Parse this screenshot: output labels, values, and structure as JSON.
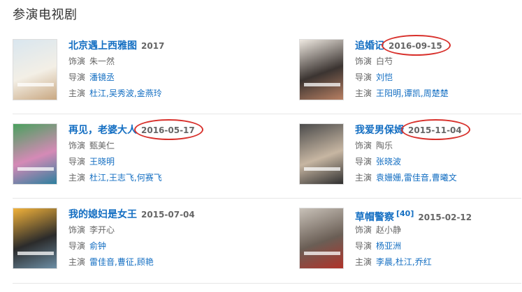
{
  "section": {
    "title": "参演电视剧"
  },
  "labels": {
    "role": "饰演",
    "director": "导演",
    "cast": "主演"
  },
  "dramas": [
    {
      "title": "北京遇上西雅图",
      "sup": "",
      "date": "2017",
      "role": "朱一然",
      "director": "潘镜丞",
      "cast": [
        "杜江",
        "吴秀波",
        "金燕玲"
      ],
      "poster_colors": [
        "#d9e6ef",
        "#f3efe6",
        "#c9a882"
      ],
      "highlighted": false
    },
    {
      "title": "追婚记",
      "sup": "",
      "date": "2016-09-15",
      "role": "白芍",
      "director": "刘恺",
      "cast": [
        "王阳明",
        "谭凯",
        "周楚楚"
      ],
      "poster_colors": [
        "#efe9e1",
        "#3b3431",
        "#b87f62"
      ],
      "highlighted": true
    },
    {
      "title": "再见，老婆大人",
      "sup": "",
      "date": "2016-05-17",
      "role": "甄美仁",
      "director": "王晓明",
      "cast": [
        "杜江",
        "王志飞",
        "何赛飞"
      ],
      "poster_colors": [
        "#4aa15e",
        "#d58ab6",
        "#2d7f9e"
      ],
      "highlighted": true
    },
    {
      "title": "我爱男保姆",
      "sup": "",
      "date": "2015-11-04",
      "role": "陶乐",
      "director": "张晓波",
      "cast": [
        "袁姗姗",
        "雷佳音",
        "曹曦文"
      ],
      "poster_colors": [
        "#4b4b4b",
        "#c7b6a2",
        "#2f2f2f"
      ],
      "highlighted": true
    },
    {
      "title": "我的媳妇是女王",
      "sup": "",
      "date": "2015-07-04",
      "role": "李开心",
      "director": "俞钟",
      "cast": [
        "雷佳音",
        "曹征",
        "顾艳"
      ],
      "poster_colors": [
        "#f2b23a",
        "#2b2b2b",
        "#6c8ea5"
      ],
      "highlighted": false
    },
    {
      "title": "草帽警察",
      "sup": "[40]",
      "date": "2015-02-12",
      "role": "赵小静",
      "director": "杨亚洲",
      "cast": [
        "李晨",
        "杜江",
        "乔红"
      ],
      "poster_colors": [
        "#c8c1b8",
        "#6a5e55",
        "#b0332a"
      ],
      "highlighted": false
    }
  ]
}
